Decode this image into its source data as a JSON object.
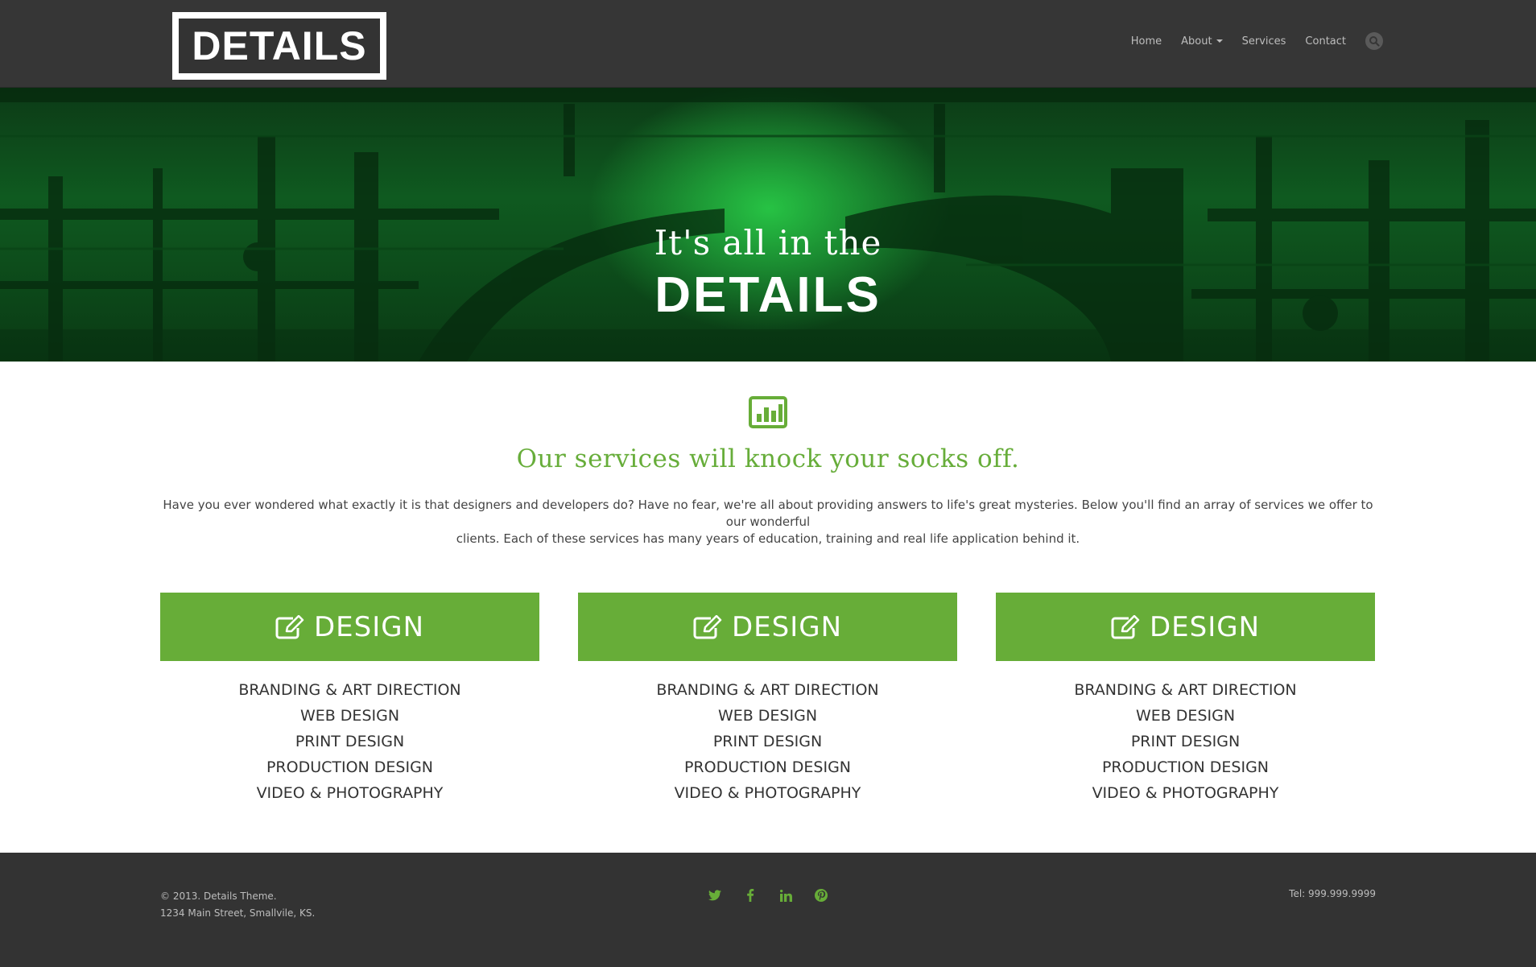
{
  "header": {
    "logo_text": "DETAILS",
    "nav": [
      {
        "label": "Home"
      },
      {
        "label": "About"
      },
      {
        "label": "Services"
      },
      {
        "label": "Contact"
      }
    ]
  },
  "hero": {
    "line1": "It's all in the",
    "line2": "DETAILS"
  },
  "services": {
    "heading": "Our services will knock your socks off.",
    "intro_line1": "Have you ever wondered what exactly it is that designers and developers do? Have no fear, we're all about providing answers to life's great mysteries. Below you'll find an array of services we offer to our wonderful",
    "intro_line2": "clients. Each of these services has many years of education, training and real life application behind it.",
    "columns": [
      {
        "title": "DESIGN",
        "items": [
          "BRANDING & ART DIRECTION",
          "WEB DESIGN",
          "PRINT DESIGN",
          "PRODUCTION DESIGN",
          "VIDEO & PHOTOGRAPHY"
        ]
      },
      {
        "title": "DESIGN",
        "items": [
          "BRANDING & ART DIRECTION",
          "WEB DESIGN",
          "PRINT DESIGN",
          "PRODUCTION DESIGN",
          "VIDEO & PHOTOGRAPHY"
        ]
      },
      {
        "title": "DESIGN",
        "items": [
          "BRANDING & ART DIRECTION",
          "WEB DESIGN",
          "PRINT DESIGN",
          "PRODUCTION DESIGN",
          "VIDEO & PHOTOGRAPHY"
        ]
      }
    ]
  },
  "footer": {
    "copyright": "© 2013. Details Theme.",
    "address": "1234 Main Street, Smallvile, KS.",
    "phone": "Tel: 999.999.9999",
    "social": [
      "twitter-icon",
      "facebook-icon",
      "linkedin-icon",
      "pinterest-icon"
    ]
  },
  "colors": {
    "accent": "#67ad38",
    "header_bg": "#363636",
    "footer_bg": "#333333"
  }
}
